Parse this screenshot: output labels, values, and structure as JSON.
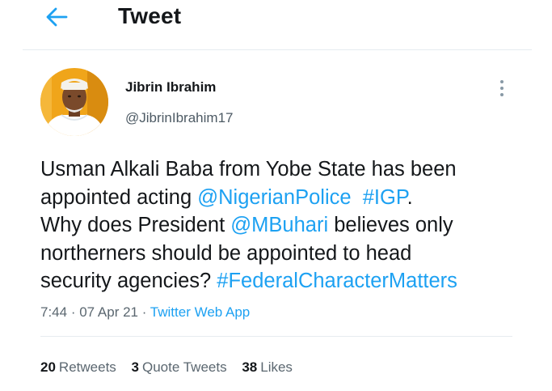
{
  "header": {
    "back_icon": "arrow-left-icon",
    "title": "Tweet"
  },
  "author": {
    "name": "Jibrin Ibrahim",
    "handle": "@JibrinIbrahim17"
  },
  "menu": {
    "icon": "more-vertical-icon"
  },
  "tweet": {
    "line1": "Usman Alkali Baba from Yobe State has been",
    "line2_prefix": "appointed acting ",
    "mention_police": "@NigerianPolice",
    "hashtag_igp": "#IGP",
    "line2_suffix": ".",
    "line3_prefix": "Why does President ",
    "mention_buhari": "@MBuhari",
    "line3_suffix": " believes only",
    "line4": "northerners should be appointed to head",
    "line5_prefix": "security agencies? ",
    "hashtag_fcm": "#FederalCharacterMatters"
  },
  "meta": {
    "time": "7:44",
    "separator": " · ",
    "date": "07 Apr 21",
    "source": "Twitter Web App"
  },
  "stats": {
    "retweets_count": "20",
    "retweets_label": "Retweets",
    "quotes_count": "3",
    "quotes_label": "Quote Tweets",
    "likes_count": "38",
    "likes_label": "Likes"
  },
  "colors": {
    "accent": "#1da1f2",
    "text": "#14171a",
    "muted": "#5b6770",
    "divider": "#e6ecf0"
  }
}
